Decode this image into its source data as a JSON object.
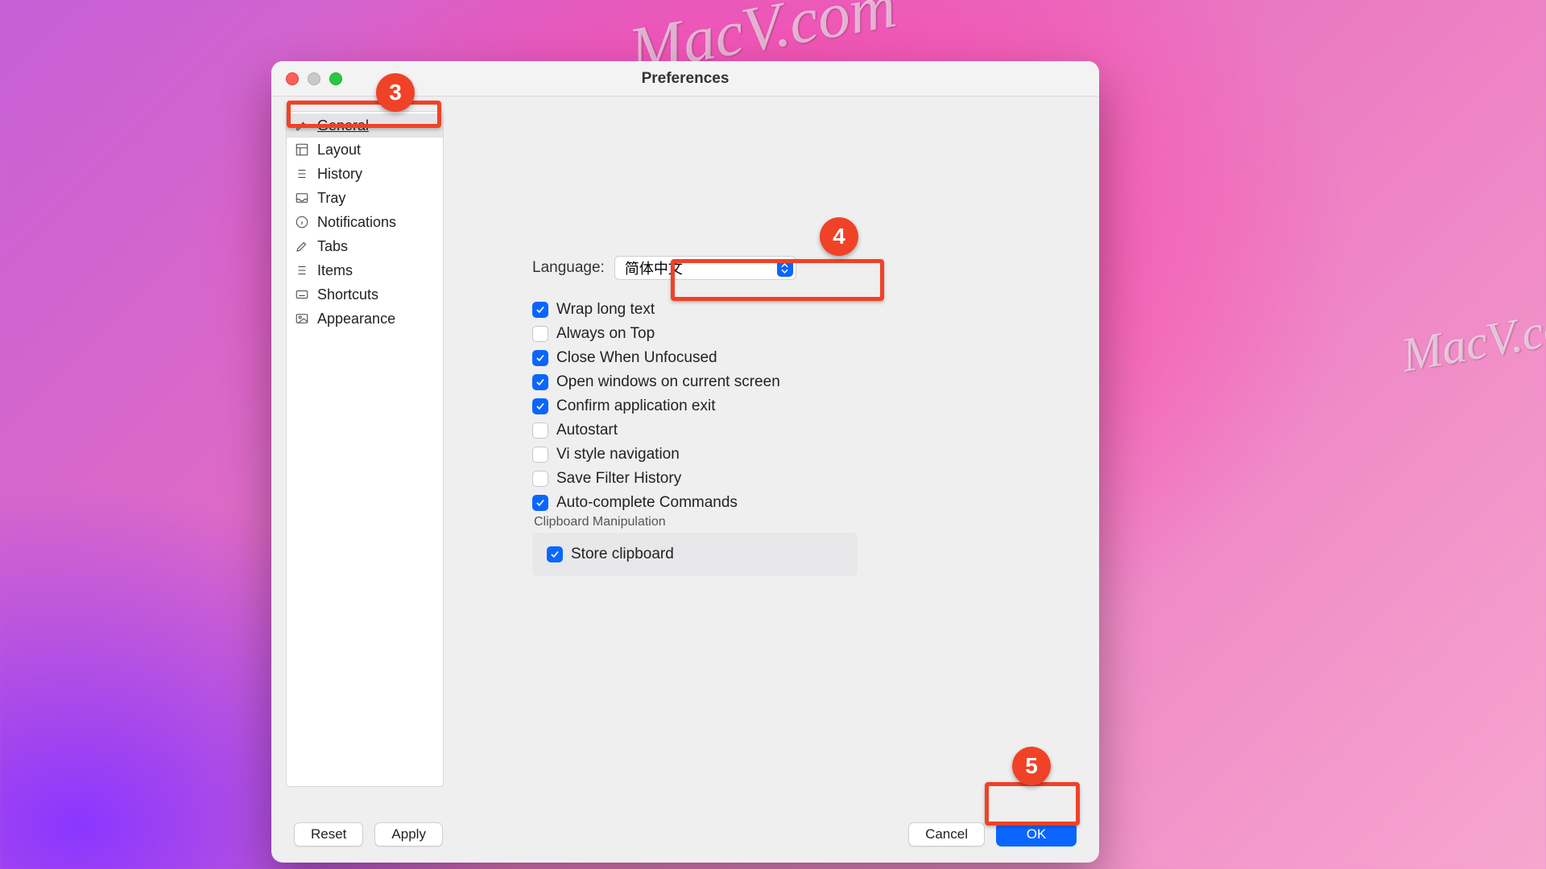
{
  "window": {
    "title": "Preferences"
  },
  "sidebar": {
    "items": [
      {
        "label": "General"
      },
      {
        "label": "Layout"
      },
      {
        "label": "History"
      },
      {
        "label": "Tray"
      },
      {
        "label": "Notifications"
      },
      {
        "label": "Tabs"
      },
      {
        "label": "Items"
      },
      {
        "label": "Shortcuts"
      },
      {
        "label": "Appearance"
      }
    ]
  },
  "general": {
    "language_label": "Language:",
    "language_value": "简体中文",
    "checks": [
      {
        "label": "Wrap long text",
        "checked": true
      },
      {
        "label": "Always on Top",
        "checked": false
      },
      {
        "label": "Close When Unfocused",
        "checked": true
      },
      {
        "label": "Open windows on current screen",
        "checked": true
      },
      {
        "label": "Confirm application exit",
        "checked": true
      },
      {
        "label": "Autostart",
        "checked": false
      },
      {
        "label": "Vi style navigation",
        "checked": false
      },
      {
        "label": "Save Filter History",
        "checked": false
      },
      {
        "label": "Auto-complete Commands",
        "checked": true
      }
    ],
    "clipboard_group_label": "Clipboard Manipulation",
    "store_clipboard": {
      "label": "Store clipboard",
      "checked": true
    }
  },
  "footer": {
    "reset": "Reset",
    "apply": "Apply",
    "cancel": "Cancel",
    "ok": "OK"
  },
  "callouts": {
    "c3": "3",
    "c4": "4",
    "c5": "5"
  },
  "watermarks": {
    "a": "MacV.com",
    "b": "MacV.co",
    "c": "MacV.com"
  }
}
